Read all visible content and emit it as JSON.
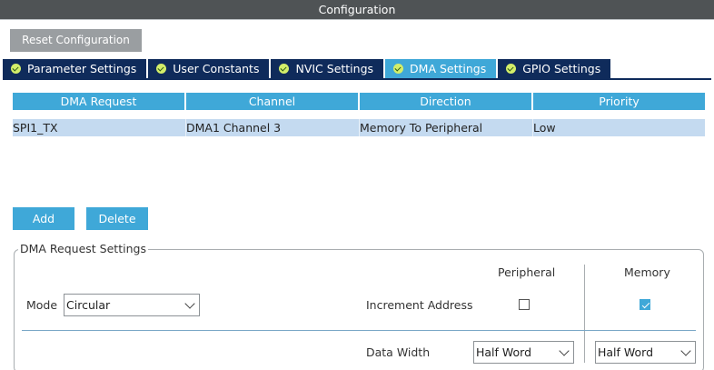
{
  "window": {
    "title": "Configuration"
  },
  "toolbar": {
    "reset_label": "Reset Configuration"
  },
  "tabs": [
    {
      "label": "Parameter Settings",
      "active": false
    },
    {
      "label": "User Constants",
      "active": false
    },
    {
      "label": "NVIC Settings",
      "active": false
    },
    {
      "label": "DMA Settings",
      "active": true
    },
    {
      "label": "GPIO Settings",
      "active": false
    }
  ],
  "dma_table": {
    "columns": [
      "DMA Request",
      "Channel",
      "Direction",
      "Priority"
    ],
    "rows": [
      [
        "SPI1_TX",
        "DMA1 Channel 3",
        "Memory To Peripheral",
        "Low"
      ]
    ]
  },
  "actions": {
    "add_label": "Add",
    "delete_label": "Delete"
  },
  "request_settings": {
    "legend": "DMA Request Settings",
    "peripheral_header": "Peripheral",
    "memory_header": "Memory",
    "mode_label": "Mode",
    "mode_value": "Circular",
    "increment_label": "Increment Address",
    "increment_peripheral": false,
    "increment_memory": true,
    "data_width_label": "Data Width",
    "peripheral_width": "Half Word",
    "memory_width": "Half Word"
  },
  "colors": {
    "accent": "#3fa8d8",
    "tab_dark": "#0f2b5b",
    "check_green": "#d3ee6a",
    "selected_row": "#c4daf0"
  }
}
